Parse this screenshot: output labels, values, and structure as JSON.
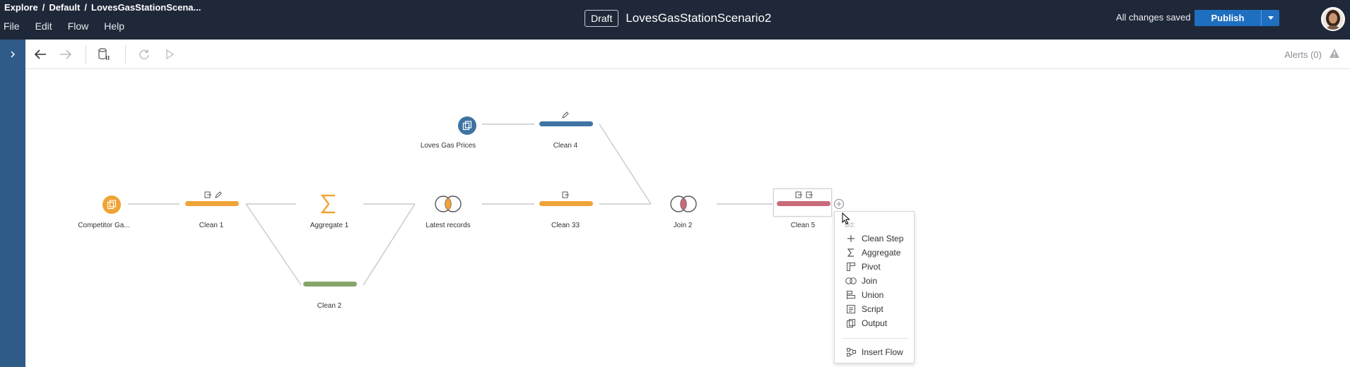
{
  "breadcrumb": {
    "part1": "Explore",
    "part2": "Default",
    "part3": "LovesGasStationScena...",
    "sep": "/"
  },
  "menu_bar": [
    "File",
    "Edit",
    "Flow",
    "Help"
  ],
  "header": {
    "draft_badge": "Draft",
    "flow_title": "LovesGasStationScenario2",
    "save_status": "All changes saved",
    "publish_label": "Publish"
  },
  "toolbar": {
    "alerts_label": "Alerts (0)"
  },
  "nodes": {
    "competitor": "Competitor Ga...",
    "clean1": "Clean 1",
    "aggregate1": "Aggregate 1",
    "clean2": "Clean 2",
    "latest": "Latest records",
    "loves_prices": "Loves Gas Prices",
    "clean4": "Clean 4",
    "clean33": "Clean 33",
    "join2": "Join 2",
    "clean5": "Clean 5"
  },
  "add_menu": {
    "header": "dd:",
    "items": [
      "Clean Step",
      "Aggregate",
      "Pivot",
      "Join",
      "Union",
      "Script",
      "Output"
    ],
    "insert_flow": "Insert Flow"
  },
  "colors": {
    "topbar": "#1f2838",
    "rail": "#2f5b88",
    "publish": "#1f6fc0",
    "orange": "#f0a336",
    "blue": "#3d74a3",
    "green": "#86a56b",
    "pink": "#c96a7a"
  }
}
